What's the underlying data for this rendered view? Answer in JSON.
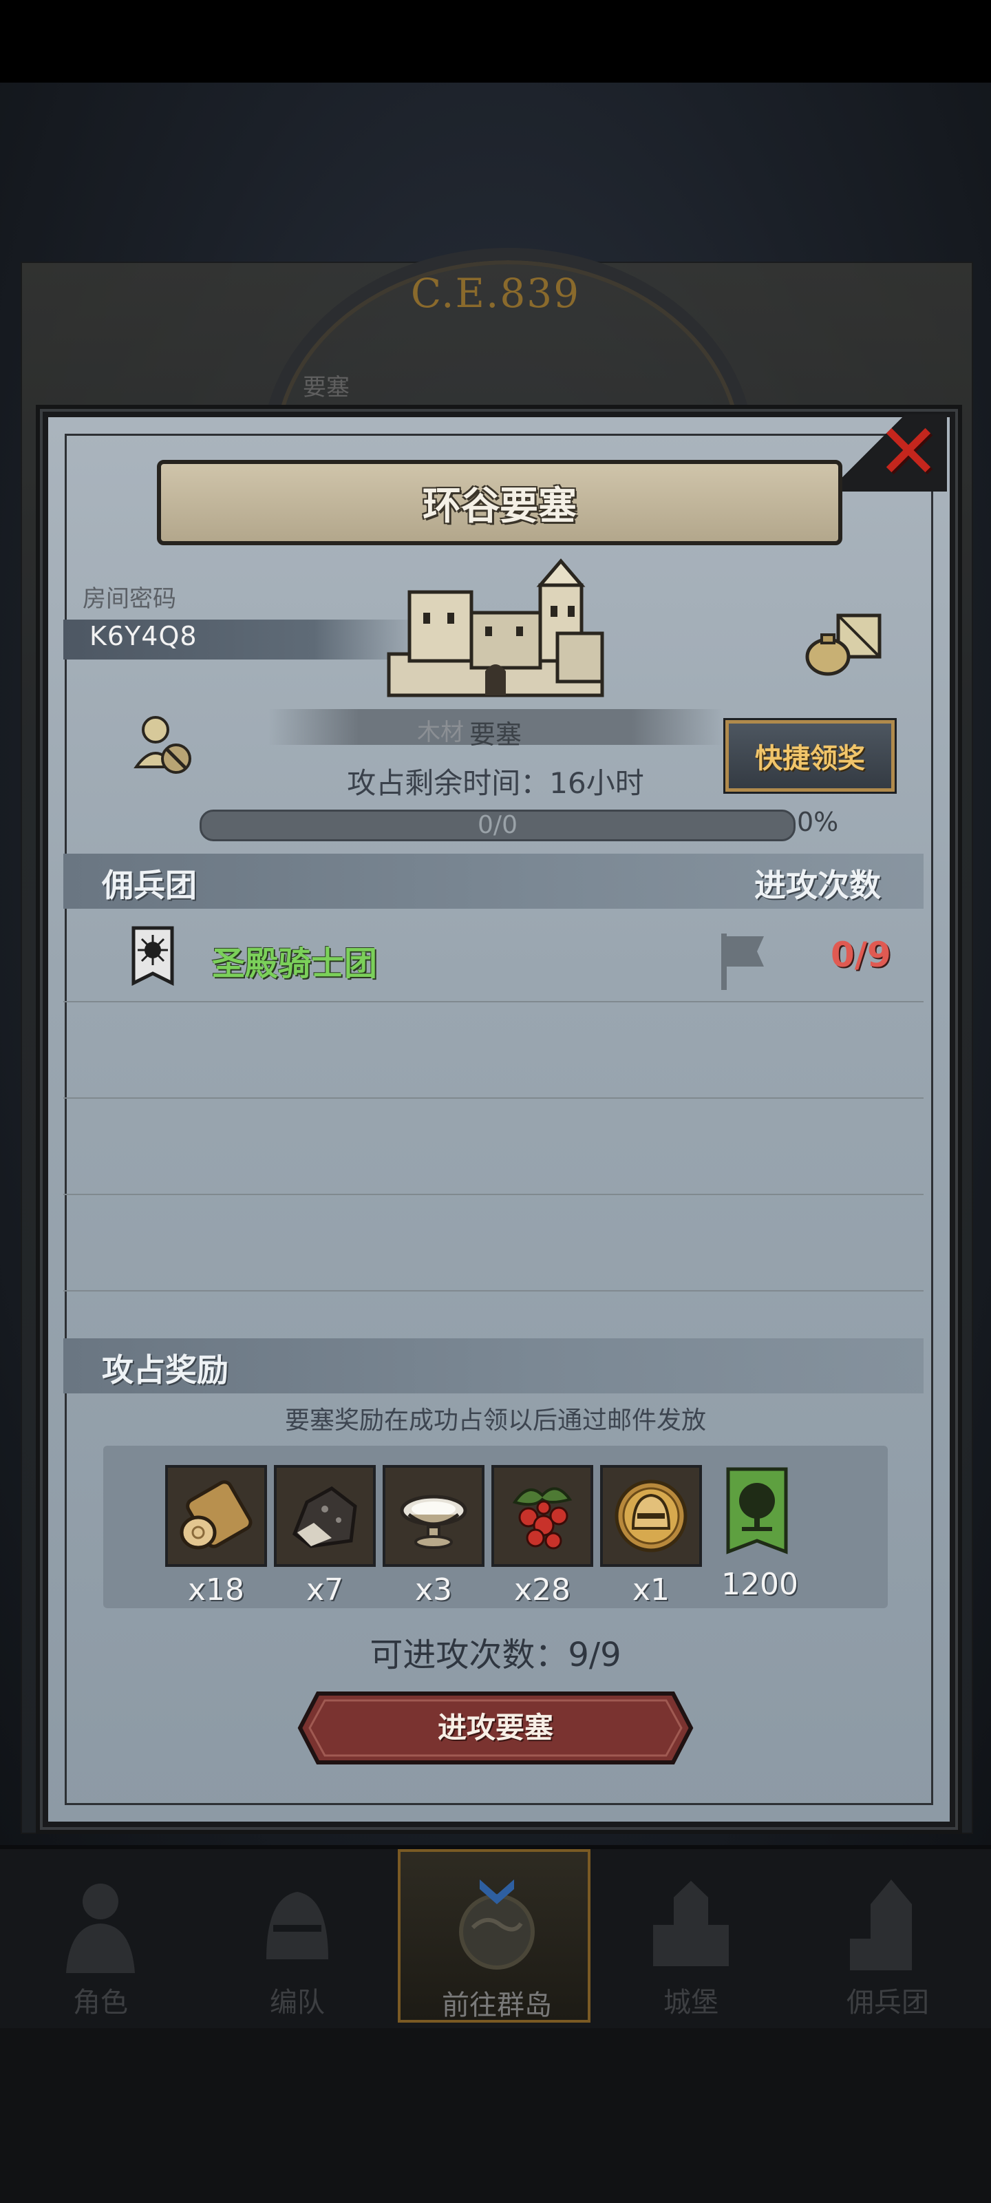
{
  "background": {
    "era_label": "C.E.839",
    "map_label": "要塞"
  },
  "dialog": {
    "title": "环谷要塞",
    "room_code_label": "房间密码",
    "room_code": "K6Y4Q8",
    "fortress_resource_label": "木材",
    "fortress_name": "要塞",
    "quick_claim_label": "快捷领奖",
    "time_remaining": "攻占剩余时间：16小时",
    "progress": {
      "label": "0/0",
      "fraction": 0,
      "percent_label": "0%"
    },
    "mercenary_header": "佣兵团",
    "attack_count_header": "进攻次数",
    "mercenaries": [
      {
        "name": "圣殿骑士团",
        "attacks": "0/9"
      }
    ],
    "rewards_header": "攻占奖励",
    "rewards_note": "要塞奖励在成功占领以后通过邮件发放",
    "rewards": [
      {
        "icon": "wood-log-icon",
        "qty": "x18"
      },
      {
        "icon": "stone-ore-icon",
        "qty": "x7"
      },
      {
        "icon": "silver-bowl-icon",
        "qty": "x3"
      },
      {
        "icon": "berries-icon",
        "qty": "x28"
      },
      {
        "icon": "knight-helmet-medal-icon",
        "qty": "x1"
      },
      {
        "icon": "tree-banner-icon",
        "qty": "1200"
      }
    ],
    "attacks_remaining": "可进攻次数：9/9",
    "attack_button_label": "进攻要塞"
  },
  "nav": [
    {
      "label": "角色",
      "icon": "knight-icon"
    },
    {
      "label": "编队",
      "icon": "helmet-icon"
    },
    {
      "label": "前往群岛",
      "icon": "globe-icon",
      "active": true
    },
    {
      "label": "城堡",
      "icon": "castle-icon"
    },
    {
      "label": "佣兵团",
      "icon": "mercenary-tower-icon"
    }
  ],
  "colors": {
    "mercenary_name": "#7bd05a",
    "attack_count": "#e05a52",
    "quick_claim_text": "#f1c56a",
    "close_x": "#c4261d",
    "attack_button": "#7a3330"
  }
}
